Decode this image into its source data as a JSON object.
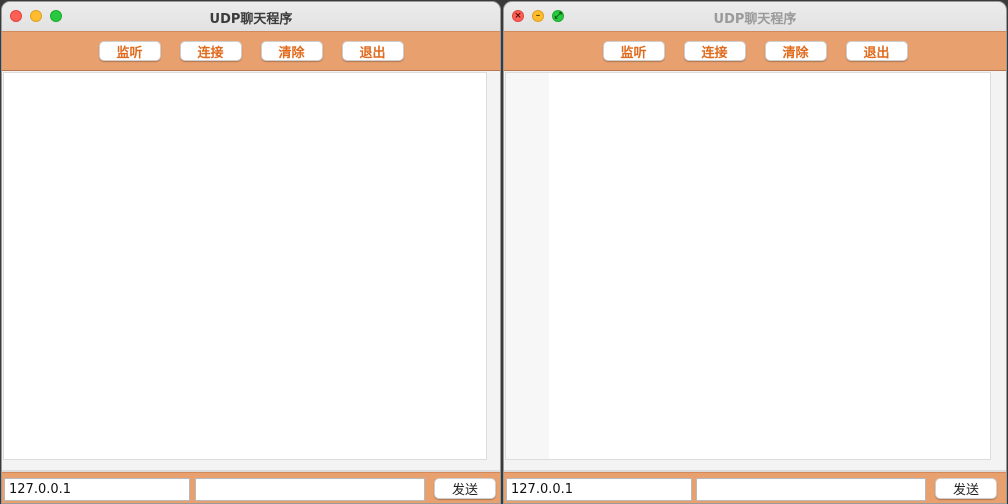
{
  "windows": [
    {
      "title": "UDP聊天程序",
      "toolbar": [
        "监听",
        "连接",
        "清除",
        "退出"
      ],
      "ip_value": "127.0.0.1",
      "message_value": "",
      "send_label": "发送"
    },
    {
      "title": "UDP聊天程序",
      "toolbar": [
        "监听",
        "连接",
        "清除",
        "退出"
      ],
      "ip_value": "127.0.0.1",
      "message_value": "",
      "send_label": "发送"
    }
  ],
  "colors": {
    "toolbar_bg": "#e8a06e",
    "button_text": "#e06a1c"
  },
  "icons": {
    "close": "close-icon",
    "minimize": "minimize-icon",
    "zoom": "zoom-icon"
  }
}
